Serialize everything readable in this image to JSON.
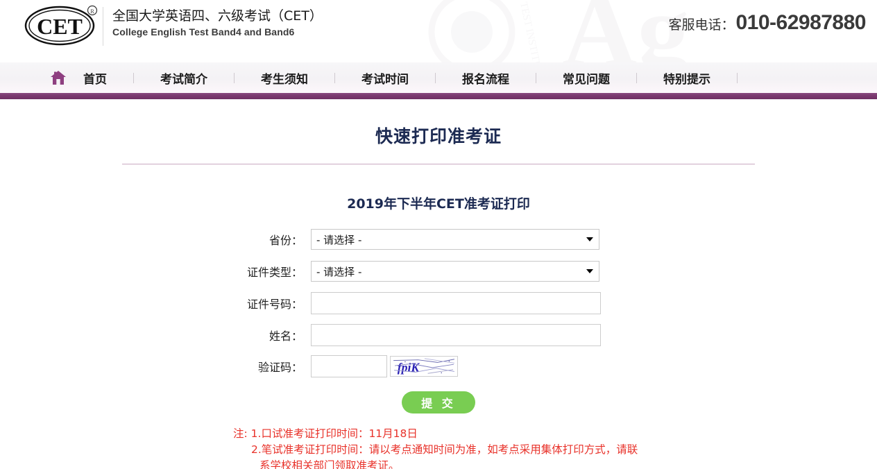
{
  "header": {
    "logo_text": "CET",
    "logo_mark": "registered-trademark",
    "brand_cn": "全国大学英语四、六级考试（CET）",
    "brand_en": "College English Test Band4 and Band6",
    "hotline_label": "客服电话：",
    "hotline_number": "010-62987880",
    "watermark_letters": "Ag"
  },
  "nav": {
    "home_icon": "home-icon",
    "items": [
      {
        "label": "首页"
      },
      {
        "label": "考试简介"
      },
      {
        "label": "考生须知"
      },
      {
        "label": "考试时间"
      },
      {
        "label": "报名流程"
      },
      {
        "label": "常见问题"
      },
      {
        "label": "特别提示"
      }
    ],
    "accent_color": "#7c3a70"
  },
  "page": {
    "title": "快速打印准考证",
    "form_title": "2019年下半年CET准考证打印",
    "title_color": "#1c2a52",
    "rule_color": "#c9a9c2"
  },
  "form": {
    "fields": [
      {
        "label": "省份：",
        "type": "select",
        "value": "- 请选择 -",
        "name": "province-select"
      },
      {
        "label": "证件类型：",
        "type": "select",
        "value": "- 请选择 -",
        "name": "id-type-select"
      },
      {
        "label": "证件号码：",
        "type": "text",
        "value": "",
        "placeholder": "",
        "name": "id-number-input"
      },
      {
        "label": "姓名：",
        "type": "text",
        "value": "",
        "placeholder": "",
        "name": "name-input"
      }
    ],
    "captcha": {
      "label": "验证码：",
      "value": "",
      "placeholder": "",
      "image_text": "fpiK",
      "image_alt": "captcha-image"
    },
    "submit_label": "提 交",
    "submit_color": "#79cd52"
  },
  "notes": {
    "line1": "注: 1.口试准考证打印时间：11月18日",
    "line2": "2.笔试准考证打印时间：请以考点通知时间为准，如考点采用集体打印方式，请联",
    "line3": "系学校相关部门领取准考证。",
    "color": "#e8322a"
  }
}
